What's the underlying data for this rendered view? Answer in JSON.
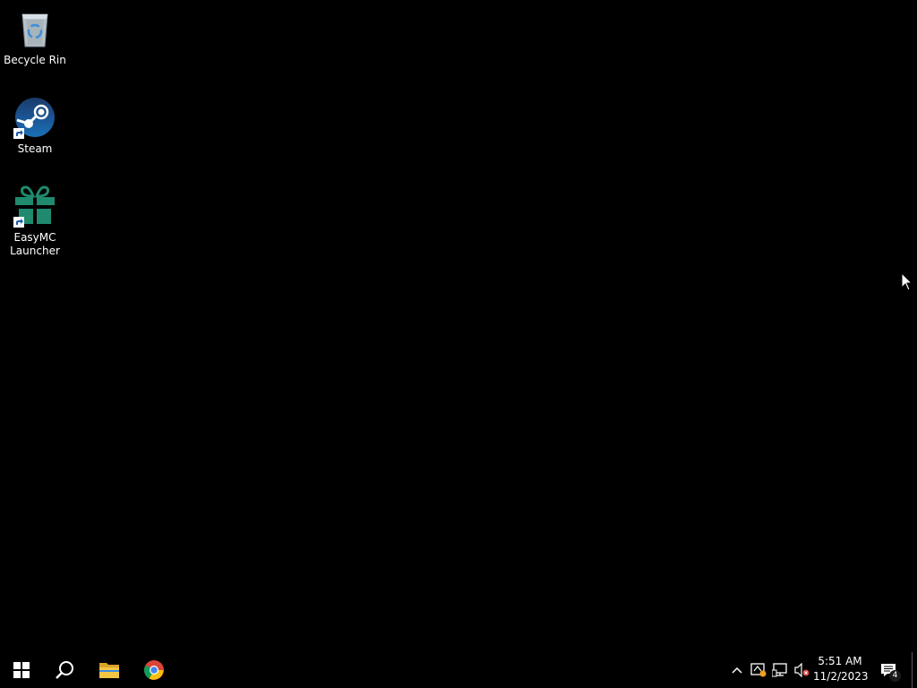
{
  "desktop": {
    "icons": [
      {
        "label": "Becycle Rin",
        "icon": "recycle-bin-icon"
      },
      {
        "label": "Steam",
        "icon": "steam-icon"
      },
      {
        "label": "EasyMC\nLauncher",
        "icon": "gift-icon"
      }
    ]
  },
  "taskbar": {
    "start_icon": "windows-logo-icon",
    "search_icon": "search-icon",
    "pinned": [
      {
        "name": "File Explorer",
        "icon": "folder-icon"
      },
      {
        "name": "Google Chrome",
        "icon": "chrome-icon"
      }
    ],
    "tray": {
      "chevron_icon": "chevron-up-icon",
      "icons": [
        "security-warning-icon",
        "network-icon",
        "volume-muted-icon"
      ]
    },
    "clock": {
      "time": "5:51 AM",
      "date": "11/2/2023"
    },
    "notifications": {
      "icon": "action-center-icon",
      "count": "4"
    }
  },
  "colors": {
    "background": "#000000",
    "steam_blue": "#1b6fb8",
    "easymc_green": "#1f8a6e",
    "folder_yellow": "#f3c544"
  }
}
